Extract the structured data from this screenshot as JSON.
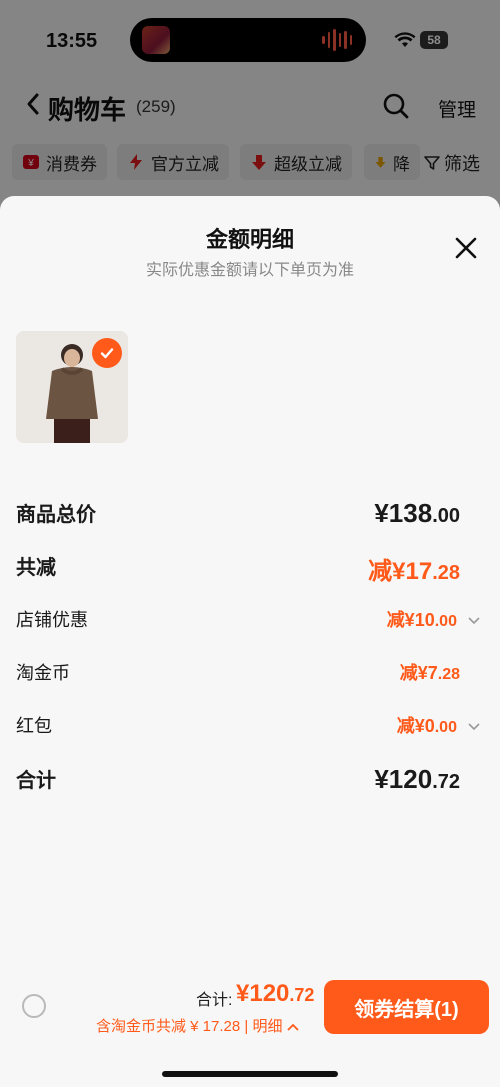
{
  "status": {
    "time": "13:55",
    "battery": "58"
  },
  "nav": {
    "title": "购物车",
    "count": "(259)",
    "manage": "管理"
  },
  "chips": [
    {
      "label": "消费券",
      "color": "#d0021b"
    },
    {
      "label": "官方立减",
      "color": "#e11b1b"
    },
    {
      "label": "超级立减",
      "color": "#e11b1b"
    },
    {
      "label": "降",
      "color": "#e0a000"
    }
  ],
  "filter_label": "筛选",
  "sheet": {
    "title": "金额明细",
    "subtitle": "实际优惠金额请以下单页为准",
    "rows": {
      "subtotal": {
        "label": "商品总价",
        "prefix": "¥138",
        "decimal": ".00"
      },
      "total_discount": {
        "label": "共减",
        "prefix": "减¥17",
        "decimal": ".28"
      },
      "store": {
        "label": "店铺优惠",
        "prefix": "减¥10",
        "decimal": ".00"
      },
      "coins": {
        "label": "淘金币",
        "prefix": "减¥7",
        "decimal": ".28"
      },
      "redpacket": {
        "label": "红包",
        "prefix": "减¥0",
        "decimal": ".00"
      },
      "total": {
        "label": "合计",
        "prefix": "¥120",
        "decimal": ".72"
      }
    }
  },
  "bottom": {
    "total_label": "合计:",
    "total_int": "¥120",
    "total_dec": ".72",
    "note": "含淘金币共减 ¥ 17.28 | 明细",
    "checkout": "领券结算(1)"
  },
  "colors": {
    "accent": "#ff5a1a"
  }
}
